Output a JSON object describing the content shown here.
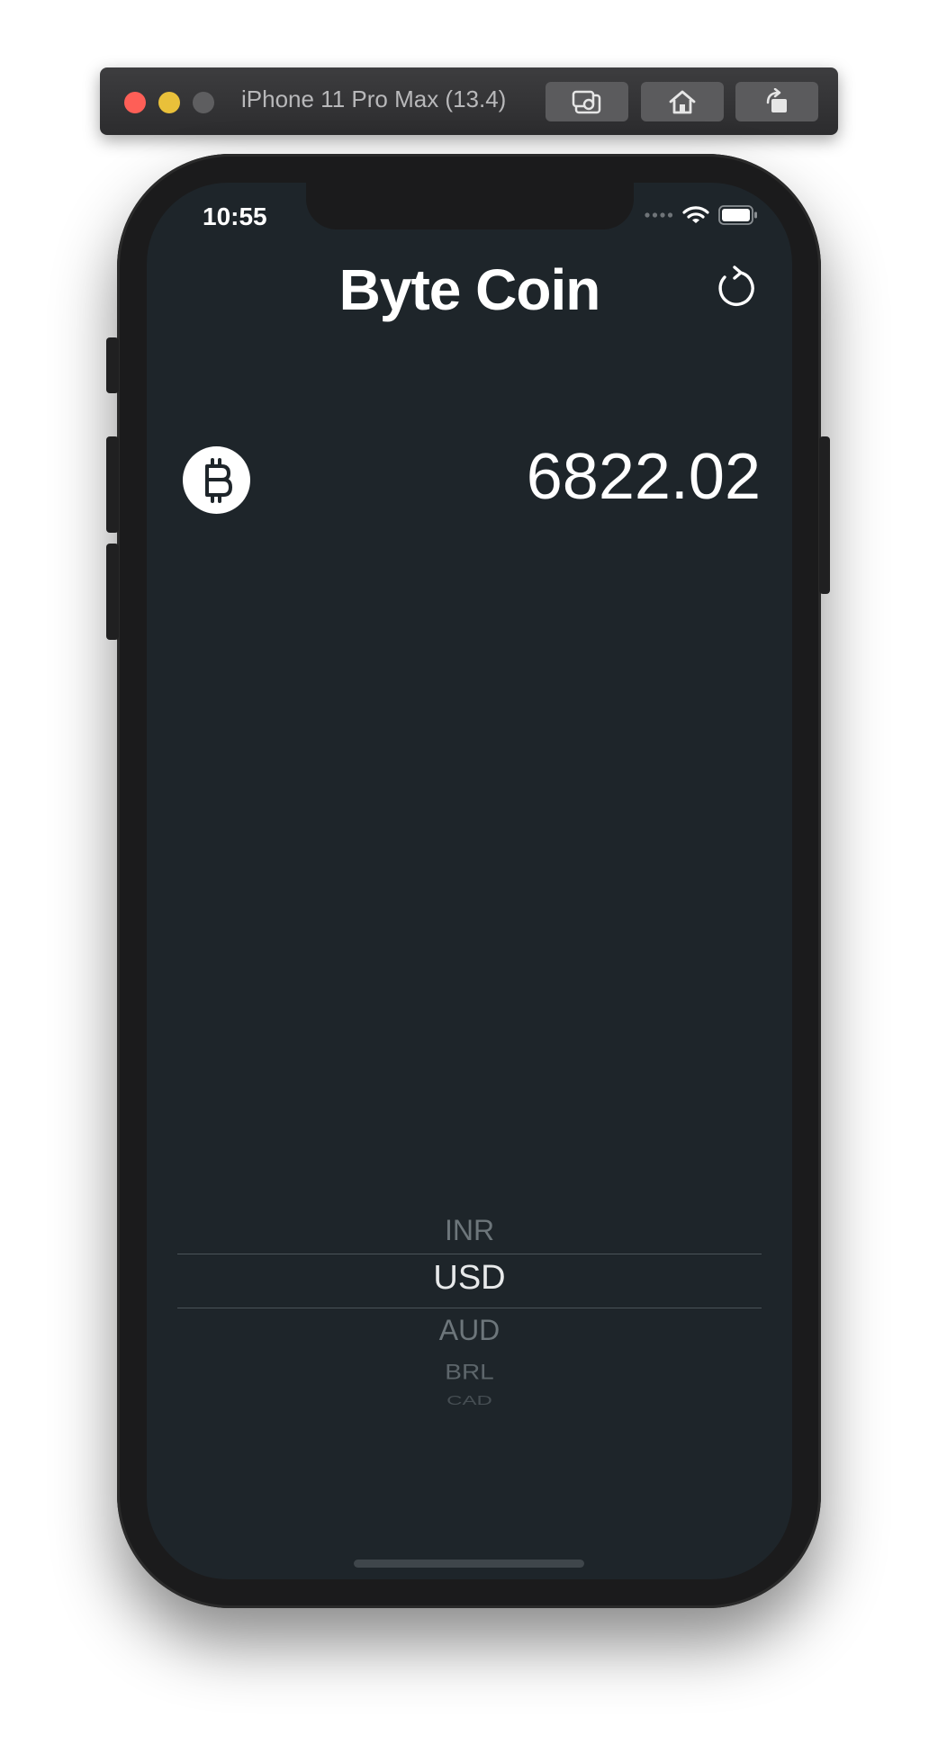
{
  "simulator": {
    "title": "iPhone 11 Pro Max (13.4)",
    "buttons": [
      {
        "icon": "screenshot-icon"
      },
      {
        "icon": "home-icon"
      },
      {
        "icon": "rotate-icon"
      }
    ]
  },
  "status_bar": {
    "time": "10:55",
    "icons": [
      "cellular-signal-icon",
      "wifi-icon",
      "battery-icon"
    ]
  },
  "app": {
    "title": "Byte Coin",
    "refresh_icon": "refresh-icon",
    "coin_icon": "bitcoin-icon",
    "price": "6822.02"
  },
  "currency_picker": {
    "options": [
      "INR",
      "USD",
      "AUD",
      "BRL",
      "CAD"
    ],
    "selected": "USD"
  },
  "colors": {
    "background": "#1e252a",
    "text": "#ffffff",
    "picker_dim": "#6d767b"
  }
}
